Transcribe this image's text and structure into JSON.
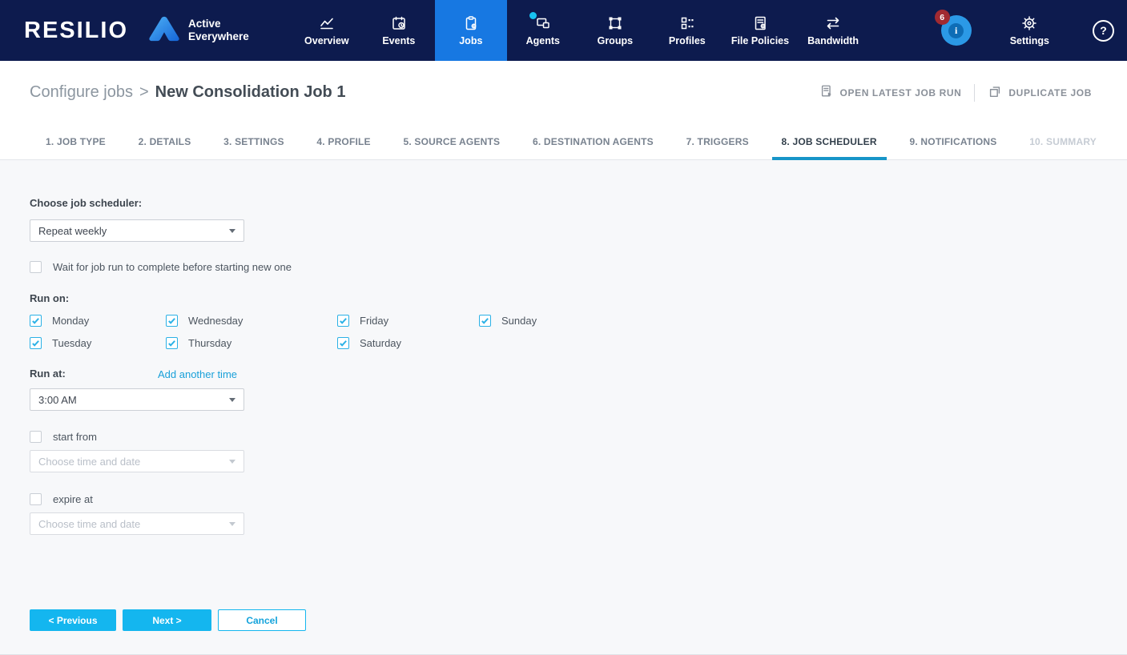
{
  "header": {
    "brand": "RESILIO",
    "product_line1": "Active",
    "product_line2": "Everywhere",
    "nav": [
      {
        "label": "Overview"
      },
      {
        "label": "Events"
      },
      {
        "label": "Jobs",
        "state": "active"
      },
      {
        "label": "Agents",
        "has_status_dot": true
      },
      {
        "label": "Groups"
      },
      {
        "label": "Profiles"
      },
      {
        "label": "File Policies"
      },
      {
        "label": "Bandwidth"
      }
    ],
    "notification_count": "6",
    "info_glyph": "i",
    "settings_label": "Settings",
    "help_glyph": "?"
  },
  "breadcrumb": {
    "parent": "Configure jobs",
    "separator": ">",
    "current": "New Consolidation Job 1"
  },
  "page_actions": {
    "open_latest_label": "OPEN LATEST JOB RUN",
    "duplicate_label": "DUPLICATE JOB"
  },
  "tabs": [
    {
      "label": "1. JOB TYPE",
      "state": "default"
    },
    {
      "label": "2. DETAILS",
      "state": "default"
    },
    {
      "label": "3. SETTINGS",
      "state": "default"
    },
    {
      "label": "4. PROFILE",
      "state": "default"
    },
    {
      "label": "5. SOURCE AGENTS",
      "state": "default"
    },
    {
      "label": "6. DESTINATION AGENTS",
      "state": "default"
    },
    {
      "label": "7. TRIGGERS",
      "state": "default"
    },
    {
      "label": "8. JOB SCHEDULER",
      "state": "active"
    },
    {
      "label": "9. NOTIFICATIONS",
      "state": "default"
    },
    {
      "label": "10. SUMMARY",
      "state": "disabled"
    }
  ],
  "form": {
    "scheduler_label": "Choose job scheduler:",
    "scheduler_value": "Repeat weekly",
    "wait_checkbox": {
      "label": "Wait for job run to complete before starting new one",
      "checked": false
    },
    "run_on_label": "Run on:",
    "days": [
      {
        "label": "Monday",
        "checked": true
      },
      {
        "label": "Wednesday",
        "checked": true
      },
      {
        "label": "Friday",
        "checked": true
      },
      {
        "label": "Sunday",
        "checked": true
      },
      {
        "label": "Tuesday",
        "checked": true
      },
      {
        "label": "Thursday",
        "checked": true
      },
      {
        "label": "Saturday",
        "checked": true
      }
    ],
    "run_at_label": "Run at:",
    "add_time_link": "Add another time",
    "run_at_value": "3:00 AM",
    "start_from": {
      "label": "start from",
      "checked": false,
      "placeholder": "Choose time and date"
    },
    "expire_at": {
      "label": "expire at",
      "checked": false,
      "placeholder": "Choose time and date"
    },
    "buttons": {
      "previous": "< Previous",
      "next": "Next >",
      "cancel": "Cancel"
    }
  },
  "colors": {
    "navbar_bg": "#0d1b4e",
    "active_nav_bg": "#1778e2",
    "accent_cyan": "#14b6ef",
    "checkbox_cyan": "#2bb1e6",
    "tab_underline": "#1795c8",
    "link_blue": "#19a0d9",
    "badge_red": "#a12a31",
    "info_button_blue": "#2b99e6",
    "agents_dot_cyan": "#17c3f2",
    "content_bg": "#f7f8fa"
  }
}
